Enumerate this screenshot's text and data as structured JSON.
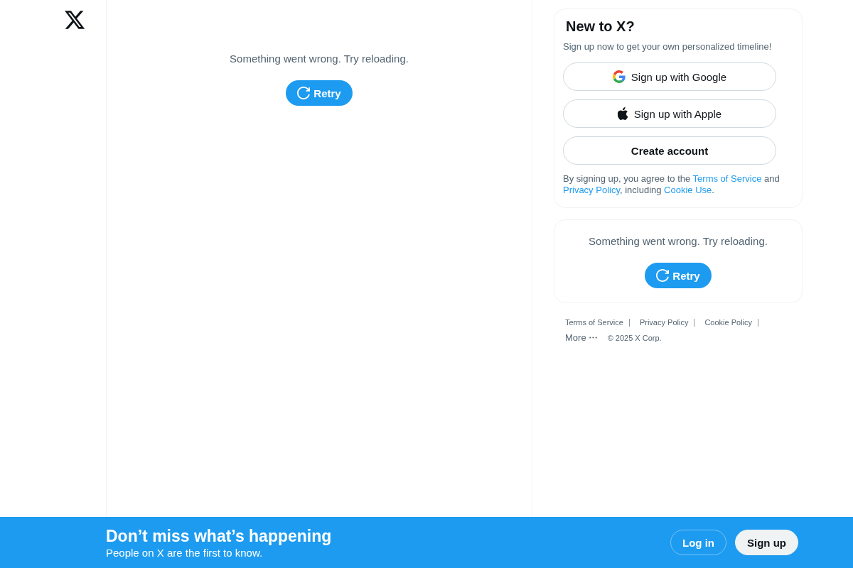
{
  "main_column": {
    "error_message": "Something went wrong. Try reloading.",
    "retry_button": "Retry"
  },
  "signup_card": {
    "title": "New to X?",
    "subtitle": "Sign up now to get your own personalized timeline!",
    "buttons": [
      {
        "kind": "google",
        "label": "Sign up with Google"
      },
      {
        "kind": "apple",
        "label": "Sign up with Apple"
      },
      {
        "kind": "plain",
        "label": "Create account"
      }
    ],
    "legal": [
      {
        "kind": "text",
        "text": "By signing up, you agree to the "
      },
      {
        "kind": "link",
        "text": "Terms of Service"
      },
      {
        "kind": "text",
        "text": " and "
      },
      {
        "kind": "link",
        "text": "Privacy Policy"
      },
      {
        "kind": "text",
        "text": ", including "
      },
      {
        "kind": "link",
        "text": "Cookie Use"
      },
      {
        "kind": "text",
        "text": "."
      }
    ]
  },
  "sidebar_error_card": {
    "error_message": "Something went wrong. Try reloading.",
    "retry_button": "Retry"
  },
  "footer": {
    "links": [
      "Terms of Service",
      "Privacy Policy",
      "Cookie Policy"
    ],
    "more_button": "More",
    "copyright": "© 2025 X Corp."
  },
  "bottom_banner": {
    "title": "Don’t miss what’s happening",
    "subtitle": "People on X are the first to know.",
    "buttons": [
      {
        "kind": "outline",
        "label": "Log in"
      },
      {
        "kind": "filled",
        "label": "Sign up"
      }
    ]
  }
}
